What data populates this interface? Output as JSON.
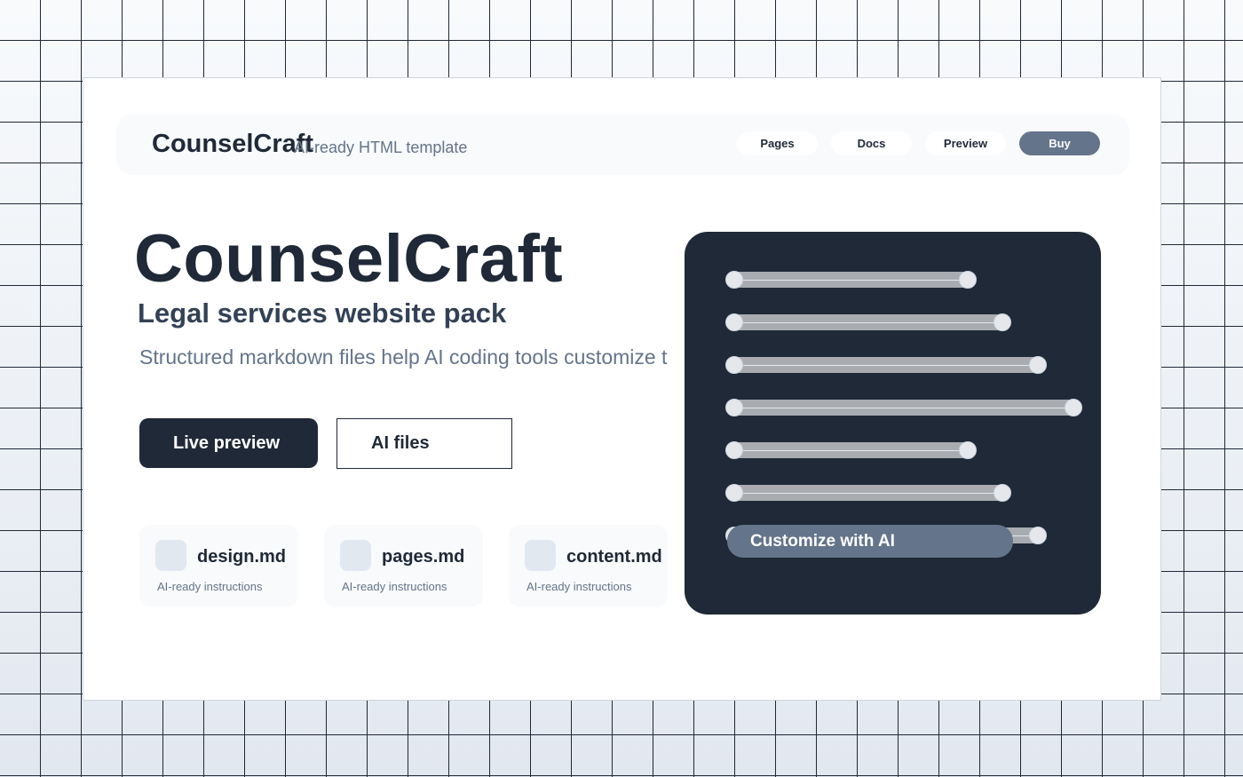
{
  "topbar": {
    "brand": "CounselCraft",
    "tagline": "AI-ready HTML template",
    "nav": [
      {
        "label": "Pages"
      },
      {
        "label": "Docs"
      },
      {
        "label": "Preview"
      },
      {
        "label": "Buy"
      }
    ]
  },
  "hero": {
    "title": "CounselCraft",
    "subtitle": "Legal services website pack",
    "description": "Structured markdown files help AI coding tools customize t",
    "primary_button": "Live preview",
    "secondary_button": "AI files"
  },
  "cards": [
    {
      "title": "design.md",
      "subtitle": "AI-ready instructions"
    },
    {
      "title": "pages.md",
      "subtitle": "AI-ready instructions"
    },
    {
      "title": "content.md",
      "subtitle": "AI-ready instructions"
    }
  ],
  "panel": {
    "slider_levels": [
      0.7,
      0.8,
      0.9,
      1.0,
      0.7,
      0.8,
      0.9
    ],
    "customize_button": "Customize with AI"
  },
  "colors": {
    "dark": "#1f2937",
    "accent": "#64748b",
    "light": "#f8fafc"
  }
}
